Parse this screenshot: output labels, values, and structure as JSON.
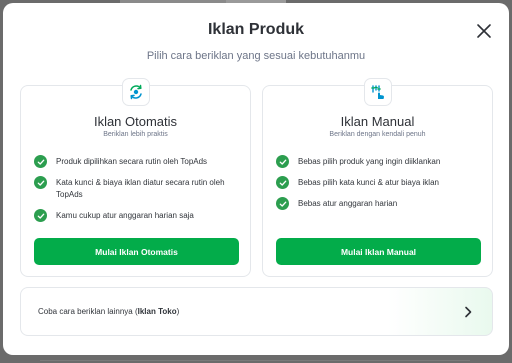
{
  "modal": {
    "title": "Iklan Produk",
    "subtitle": "Pilih cara beriklan yang sesuai kebutuhanmu"
  },
  "cards": [
    {
      "icon": "auto-sync-icon",
      "title": "Iklan Otomatis",
      "description": "Beriklan lebih praktis",
      "features": [
        "Produk dipilihkan secara rutin oleh TopAds",
        "Kata kunci & biaya iklan diatur secara rutin oleh TopAds",
        "Kamu cukup atur anggaran harian saja"
      ],
      "button": "Mulai Iklan Otomatis"
    },
    {
      "icon": "manual-control-icon",
      "title": "Iklan Manual",
      "description": "Beriklan dengan kendali penuh",
      "features": [
        "Bebas pilih produk yang ingin diiklankan",
        "Bebas pilih kata kunci & atur biaya iklan",
        "Bebas atur anggaran harian"
      ],
      "button": "Mulai Iklan Manual"
    }
  ],
  "other": {
    "prefix": "Coba cara beriklan lainnya (",
    "highlight": "Iklan Toko",
    "suffix": ")"
  },
  "colors": {
    "primary": "#03ac4a",
    "check": "#2c9e4f",
    "text": "#2e3137",
    "muted": "#6d7588"
  }
}
